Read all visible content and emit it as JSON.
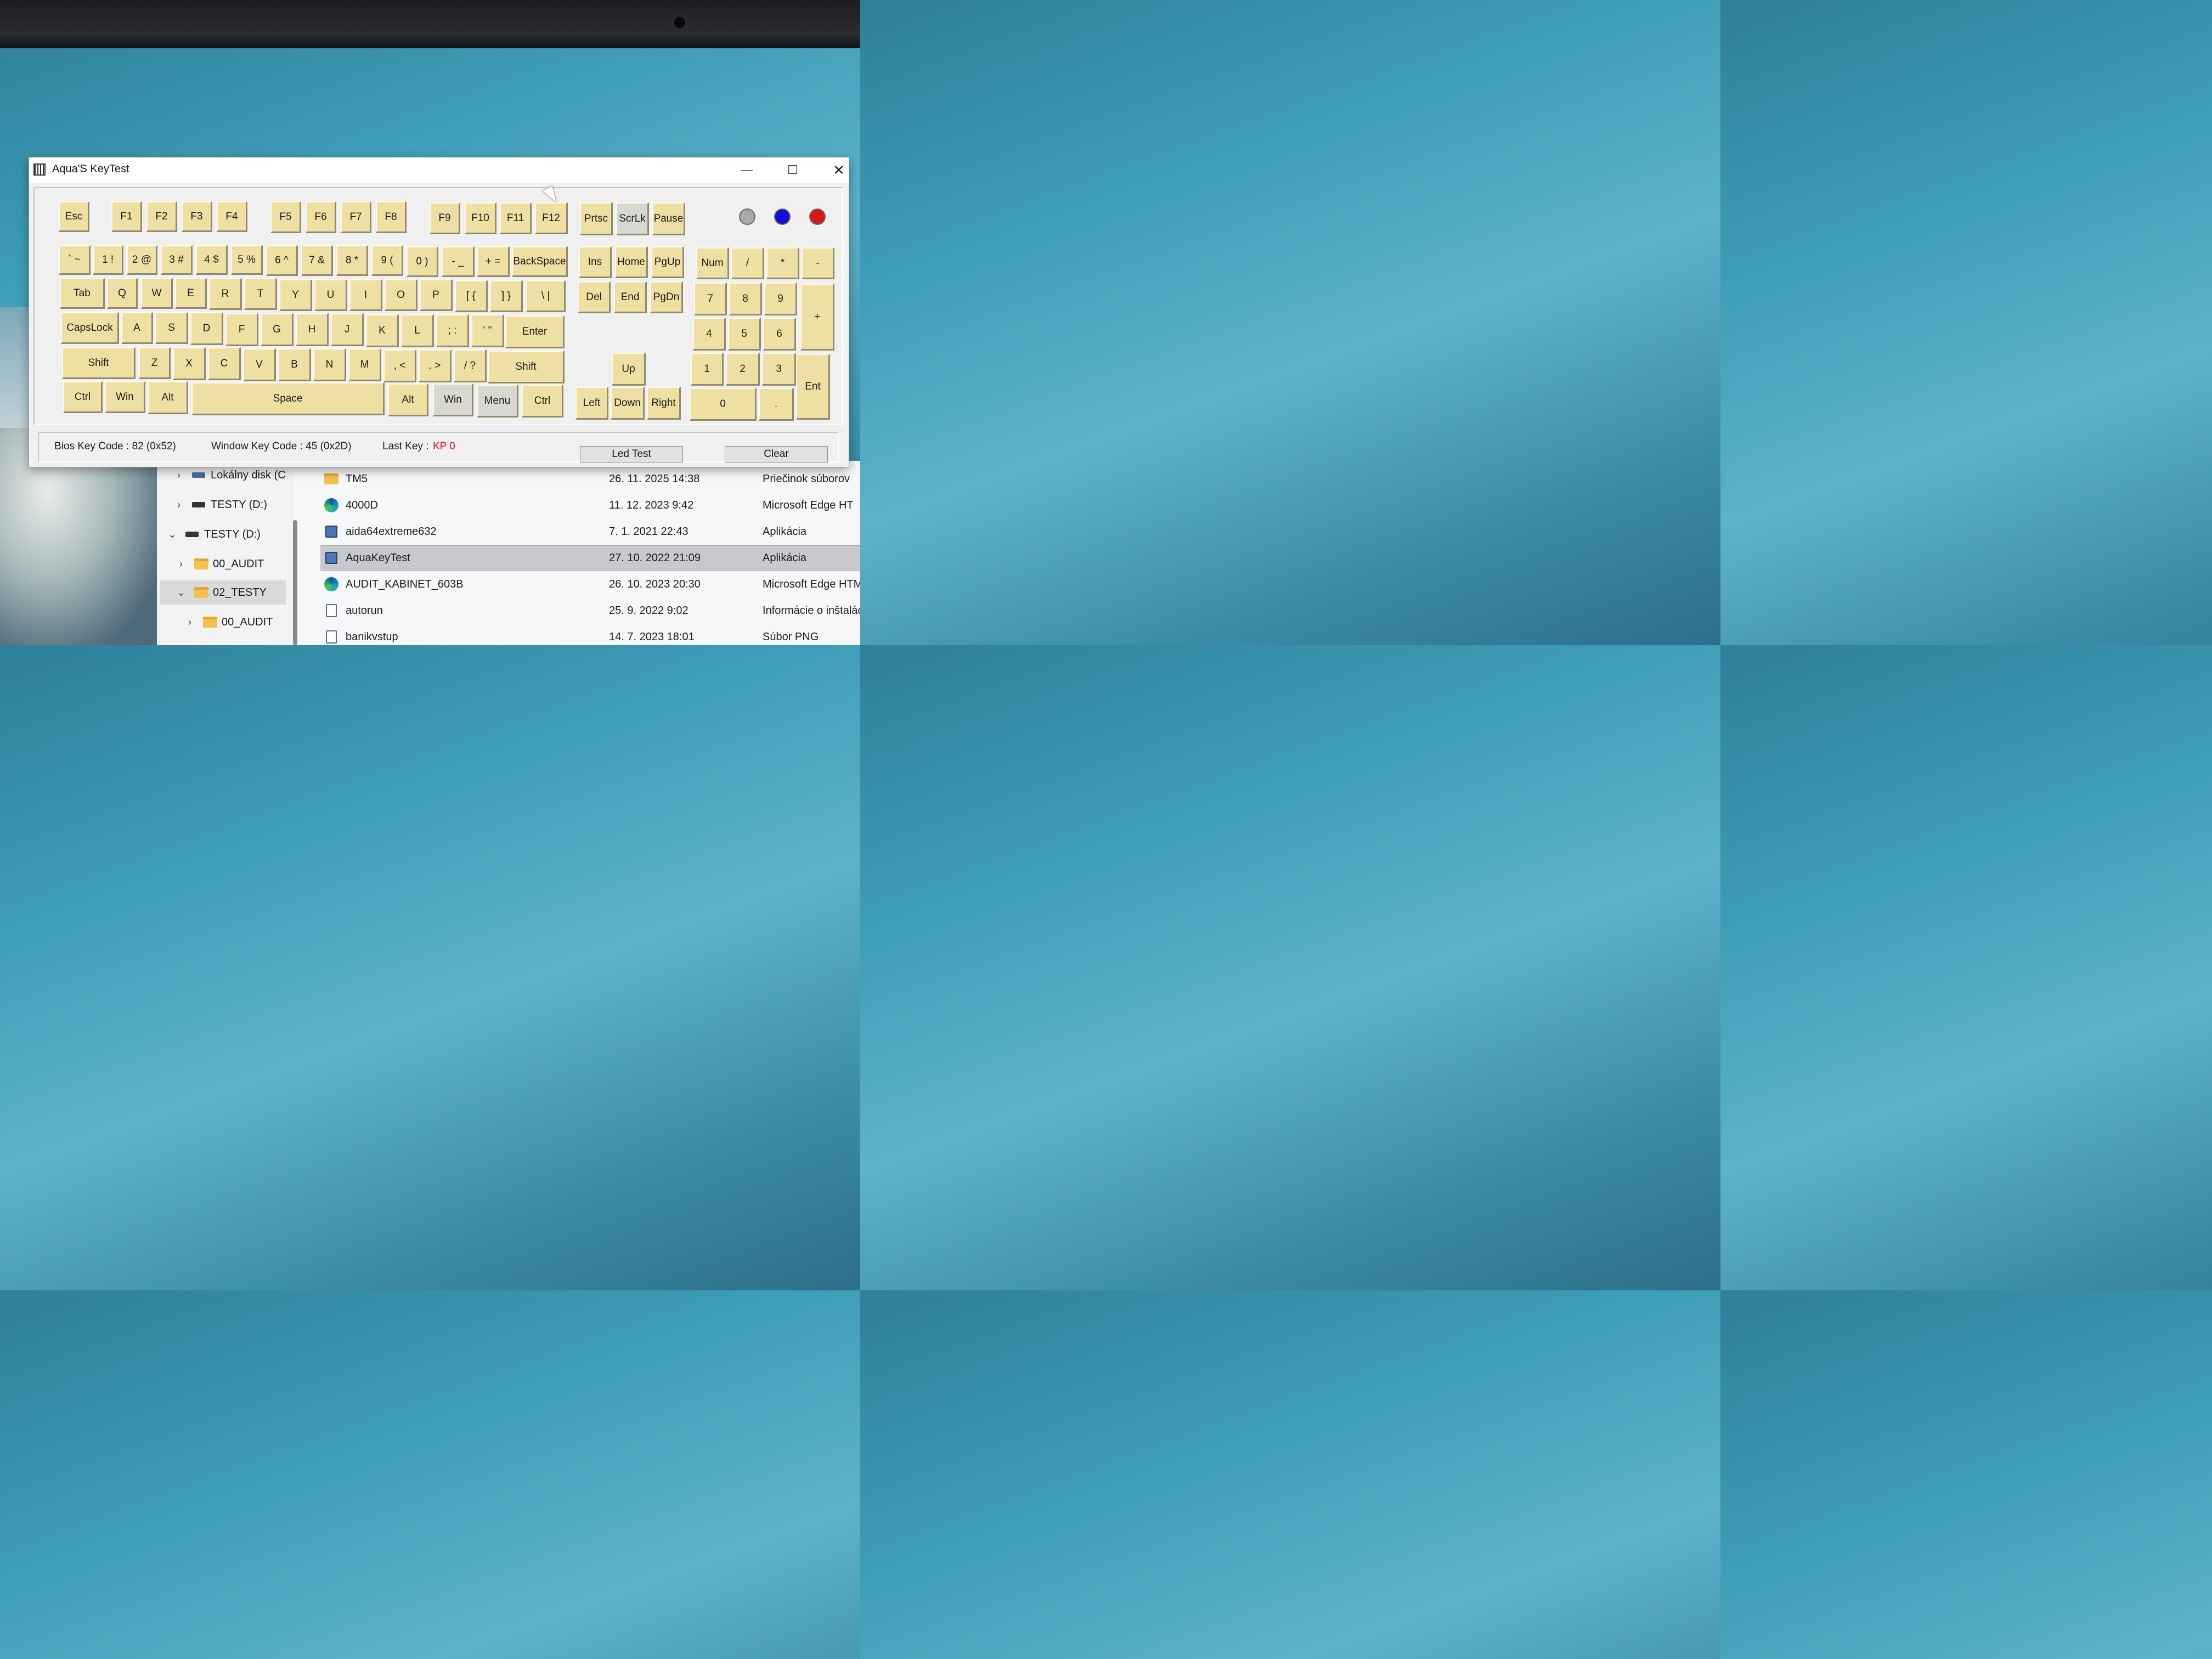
{
  "window": {
    "title": "Aqua'S KeyTest",
    "minimize": "—",
    "maximize": "☐",
    "close": "✕"
  },
  "keys": {
    "esc": "Esc",
    "f1": "F1",
    "f2": "F2",
    "f3": "F3",
    "f4": "F4",
    "f5": "F5",
    "f6": "F6",
    "f7": "F7",
    "f8": "F8",
    "f9": "F9",
    "f10": "F10",
    "f11": "F11",
    "f12": "F12",
    "prtsc": "Prtsc",
    "scrlk": "ScrLk",
    "pause": "Pause",
    "tilde": "` ~",
    "k1": "1 !",
    "k2": "2 @",
    "k3": "3 #",
    "k4": "4 $",
    "k5": "5 %",
    "k6": "6 ^",
    "k7": "7 &",
    "k8": "8 *",
    "k9": "9 (",
    "k0": "0 )",
    "minus": "- _",
    "equal": "+ =",
    "backspace": "BackSpace",
    "ins": "Ins",
    "home": "Home",
    "pgup": "PgUp",
    "num": "Num",
    "np_div": "/",
    "np_mul": "*",
    "np_minus": "-",
    "tab": "Tab",
    "q": "Q",
    "w": "W",
    "e": "E",
    "r": "R",
    "t": "T",
    "y": "Y",
    "u": "U",
    "i": "I",
    "o": "O",
    "p": "P",
    "lbr": "[ {",
    "rbr": "] }",
    "bslash": "\\ |",
    "del": "Del",
    "end": "End",
    "pgdn": "PgDn",
    "np7": "7",
    "np8": "8",
    "np9": "9",
    "np_plus": "+",
    "caps": "CapsLock",
    "a": "A",
    "s": "S",
    "d": "D",
    "f": "F",
    "g": "G",
    "h": "H",
    "j": "J",
    "k": "K",
    "l": "L",
    "semi": "; :",
    "quote": "' \"",
    "enter": "Enter",
    "np4": "4",
    "np5": "5",
    "np6": "6",
    "lshift": "Shift",
    "z": "Z",
    "x": "X",
    "c": "C",
    "v": "V",
    "b": "B",
    "n": "N",
    "m": "M",
    "comma": ", <",
    "period": ". >",
    "slash": "/ ?",
    "rshift": "Shift",
    "up": "Up",
    "np1": "1",
    "np2": "2",
    "np3": "3",
    "np_ent": "Ent",
    "lctrl": "Ctrl",
    "lwin": "Win",
    "lalt": "Alt",
    "space": "Space",
    "ralt": "Alt",
    "rwin": "Win",
    "menu": "Menu",
    "rctrl": "Ctrl",
    "left": "Left",
    "down": "Down",
    "right": "Right",
    "np0": "0",
    "np_dot": "."
  },
  "leds": {
    "gray": "#a8a8a8",
    "blue": "#1010d8",
    "red": "#d81818"
  },
  "status": {
    "bios": "Bios Key Code : 82 (0x52)",
    "window": "Window Key Code : 45 (0x2D)",
    "last_label": "Last Key :",
    "last_value": "KP 0",
    "led_test": "Led Test",
    "clear": "Clear"
  },
  "explorer": {
    "nav": [
      {
        "label": "Lokálny disk (C",
        "chev": "›"
      },
      {
        "label": "TESTY (D:)",
        "chev": "›"
      },
      {
        "label": "TESTY (D:)",
        "chev": "⌄"
      },
      {
        "label": "00_AUDIT",
        "chev": "›"
      },
      {
        "label": "02_TESTY",
        "chev": "⌄"
      },
      {
        "label": "00_AUDIT",
        "chev": "›"
      }
    ],
    "files": [
      {
        "name": "TM5",
        "date": "26. 11. 2025 14:38",
        "type": "Priečinok súborov",
        "icon": "folder-icon"
      },
      {
        "name": "4000D",
        "date": "11. 12. 2023 9:42",
        "type": "Microsoft Edge HT",
        "icon": "edge-icon"
      },
      {
        "name": "aida64extreme632",
        "date": "7. 1. 2021 22:43",
        "type": "Aplikácia",
        "icon": "app-icon"
      },
      {
        "name": "AquaKeyTest",
        "date": "27. 10. 2022 21:09",
        "type": "Aplikácia",
        "icon": "app-icon"
      },
      {
        "name": "AUDIT_KABINET_603B",
        "date": "26. 10. 2023 20:30",
        "type": "Microsoft Edge HTM",
        "icon": "edge-icon"
      },
      {
        "name": "autorun",
        "date": "25. 9. 2022 9:02",
        "type": "Informácie o inštalác",
        "icon": "file-icon"
      },
      {
        "name": "banikvstup",
        "date": "14. 7. 2023 18:01",
        "type": "Súbor PNG",
        "icon": "file-icon"
      }
    ]
  }
}
